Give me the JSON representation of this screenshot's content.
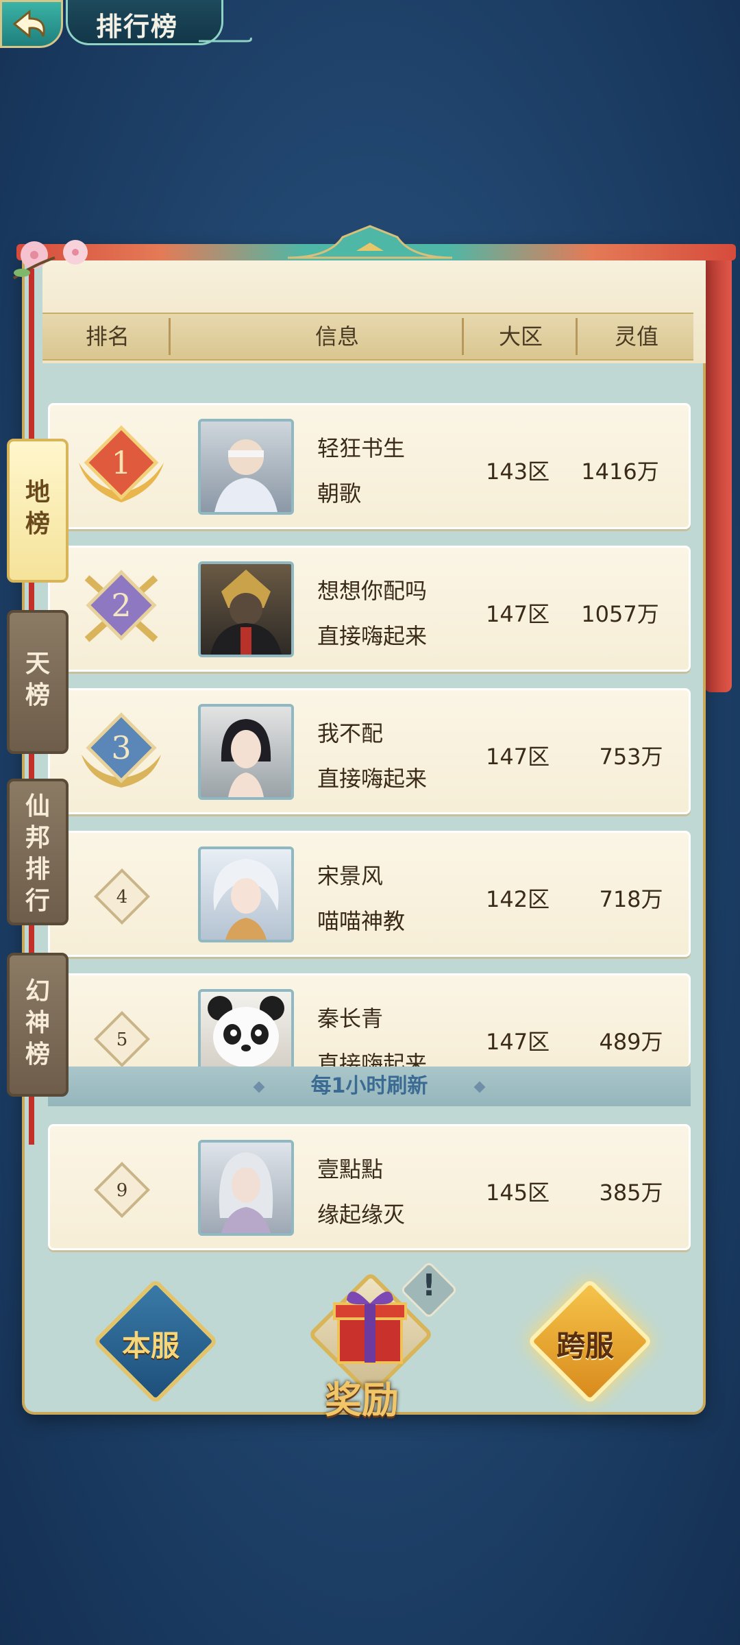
{
  "header": {
    "title": "排行榜"
  },
  "table_header": {
    "rank": "排名",
    "info": "信息",
    "region": "大区",
    "power": "灵值"
  },
  "side_tabs": [
    {
      "label_lines": [
        "地",
        "榜"
      ],
      "active": true
    },
    {
      "label_lines": [
        "天",
        "榜"
      ],
      "active": false
    },
    {
      "label_lines": [
        "仙",
        "邦",
        "排",
        "行"
      ],
      "active": false
    },
    {
      "label_lines": [
        "幻",
        "神",
        "榜"
      ],
      "active": false
    }
  ],
  "rows": [
    {
      "rank": "1",
      "name": "轻狂书生",
      "guild": "朝歌",
      "region": "143区",
      "power": "1416万"
    },
    {
      "rank": "2",
      "name": "想想你配吗",
      "guild": "直接嗨起来",
      "region": "147区",
      "power": "1057万"
    },
    {
      "rank": "3",
      "name": "我不配",
      "guild": "直接嗨起来",
      "region": "147区",
      "power": "753万"
    },
    {
      "rank": "4",
      "name": "宋景风",
      "guild": "喵喵神教",
      "region": "142区",
      "power": "718万"
    },
    {
      "rank": "5",
      "name": "秦长青",
      "guild": "直接嗨起来",
      "region": "147区",
      "power": "489万"
    }
  ],
  "refresh_note": "每1小时刷新",
  "my_row": {
    "rank": "9",
    "name": "壹點點",
    "guild": "缘起缘灭",
    "region": "145区",
    "power": "385万"
  },
  "bottom": {
    "local_server": "本服",
    "reward": "奖励",
    "cross_server": "跨服",
    "alert": "!"
  },
  "colors": {
    "accent_gold": "#f1c668",
    "panel_teal": "#bfd8d4",
    "rank1": "#e05a3e",
    "rank2": "#8f78c2",
    "rank3": "#5a86b8"
  },
  "icons": [
    "back-arrow-icon",
    "rank-1-badge-icon",
    "rank-2-badge-icon",
    "rank-3-badge-icon",
    "gift-box-icon",
    "alert-icon",
    "plum-blossom-icon"
  ]
}
